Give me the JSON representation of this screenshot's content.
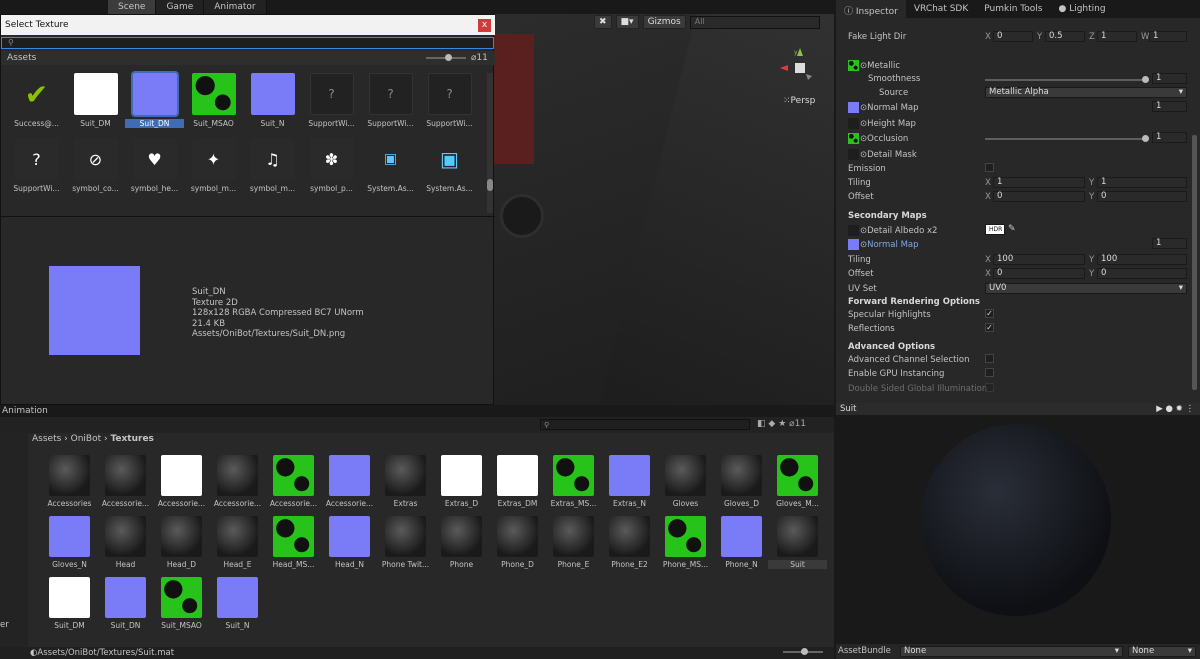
{
  "scene": {
    "tabs": [
      "Scene",
      "Game",
      "Animator"
    ],
    "gizmos": "Gizmos",
    "search_placeholder": "All",
    "persp": "Persp",
    "axis_y": "y",
    "axis_x": "x"
  },
  "dialog": {
    "title": "Select Texture",
    "close": "x",
    "folder": "Assets",
    "count": "11",
    "row1": [
      "Success@...",
      "Suit_DM",
      "Suit_DN",
      "Suit_MSAO",
      "Suit_N",
      "SupportWi...",
      "SupportWi...",
      "SupportWi..."
    ],
    "row2": [
      "SupportWi...",
      "symbol_co...",
      "symbol_he...",
      "symbol_m...",
      "symbol_m...",
      "symbol_p...",
      "System.As...",
      "System.As..."
    ],
    "info": [
      "Suit_DN",
      "Texture 2D",
      "128x128  RGBA Compressed BC7 UNorm",
      "21.4 KB",
      "Assets/OniBot/Textures/Suit_DN.png"
    ]
  },
  "inspector": {
    "tabs": [
      "Inspector",
      "VRChat SDK",
      "Pumkin Tools",
      "Lighting"
    ],
    "fake_light": {
      "label": "Fake Light Dir",
      "x": "0",
      "y": "0.5",
      "z": "1",
      "w": "1"
    },
    "metallic": "Metallic",
    "smoothness": "Smoothness",
    "smoothness_val": "1",
    "source": "Source",
    "source_val": "Metallic Alpha",
    "normal": "Normal Map",
    "normal_val": "1",
    "height": "Height Map",
    "occlusion": "Occlusion",
    "occlusion_val": "1",
    "detail_mask": "Detail Mask",
    "emission": "Emission",
    "tiling": "Tiling",
    "tiling_x": "1",
    "tiling_y": "1",
    "offset": "Offset",
    "offset_x": "0",
    "offset_y": "0",
    "secondary": "Secondary Maps",
    "detail_albedo": "Detail Albedo x2",
    "hdr": "HDR",
    "normal2": "Normal Map",
    "normal2_val": "1",
    "tiling2_x": "100",
    "tiling2_y": "100",
    "offset2_x": "0",
    "offset2_y": "0",
    "uvset": "UV Set",
    "uvset_val": "UV0",
    "forward": "Forward Rendering Options",
    "specular": "Specular Highlights",
    "reflections": "Reflections",
    "advanced": "Advanced Options",
    "adv_channel": "Advanced Channel Selection",
    "gpu": "Enable GPU Instancing",
    "double": "Double Sided Global Illumination",
    "X": "X",
    "Y": "Y",
    "Z": "Z",
    "W": "W"
  },
  "project": {
    "tab": "Animation",
    "count": "11",
    "breadcrumb": [
      "Assets",
      "OniBot",
      "Textures"
    ],
    "items": [
      "Accessories",
      "Accessorie...",
      "Accessorie...",
      "Accessorie...",
      "Accessorie...",
      "Accessorie...",
      "Extras",
      "Extras_D",
      "Extras_DM",
      "Extras_MS...",
      "Extras_N",
      "Gloves",
      "Gloves_D",
      "Gloves_M...",
      "Gloves_N",
      "Head",
      "Head_D",
      "Head_E",
      "Head_MS...",
      "Head_N",
      "Phone Twit...",
      "Phone",
      "Phone_D",
      "Phone_E",
      "Phone_E2",
      "Phone_MS...",
      "Phone_N",
      "Suit",
      "Suit_DM",
      "Suit_DN",
      "Suit_MSAO",
      "Suit_N"
    ],
    "status": "Assets/OniBot/Textures/Suit.mat",
    "left_text": "er"
  },
  "preview": {
    "title": "Suit",
    "assetbundle": "AssetBundle",
    "none1": "None",
    "none2": "None"
  }
}
